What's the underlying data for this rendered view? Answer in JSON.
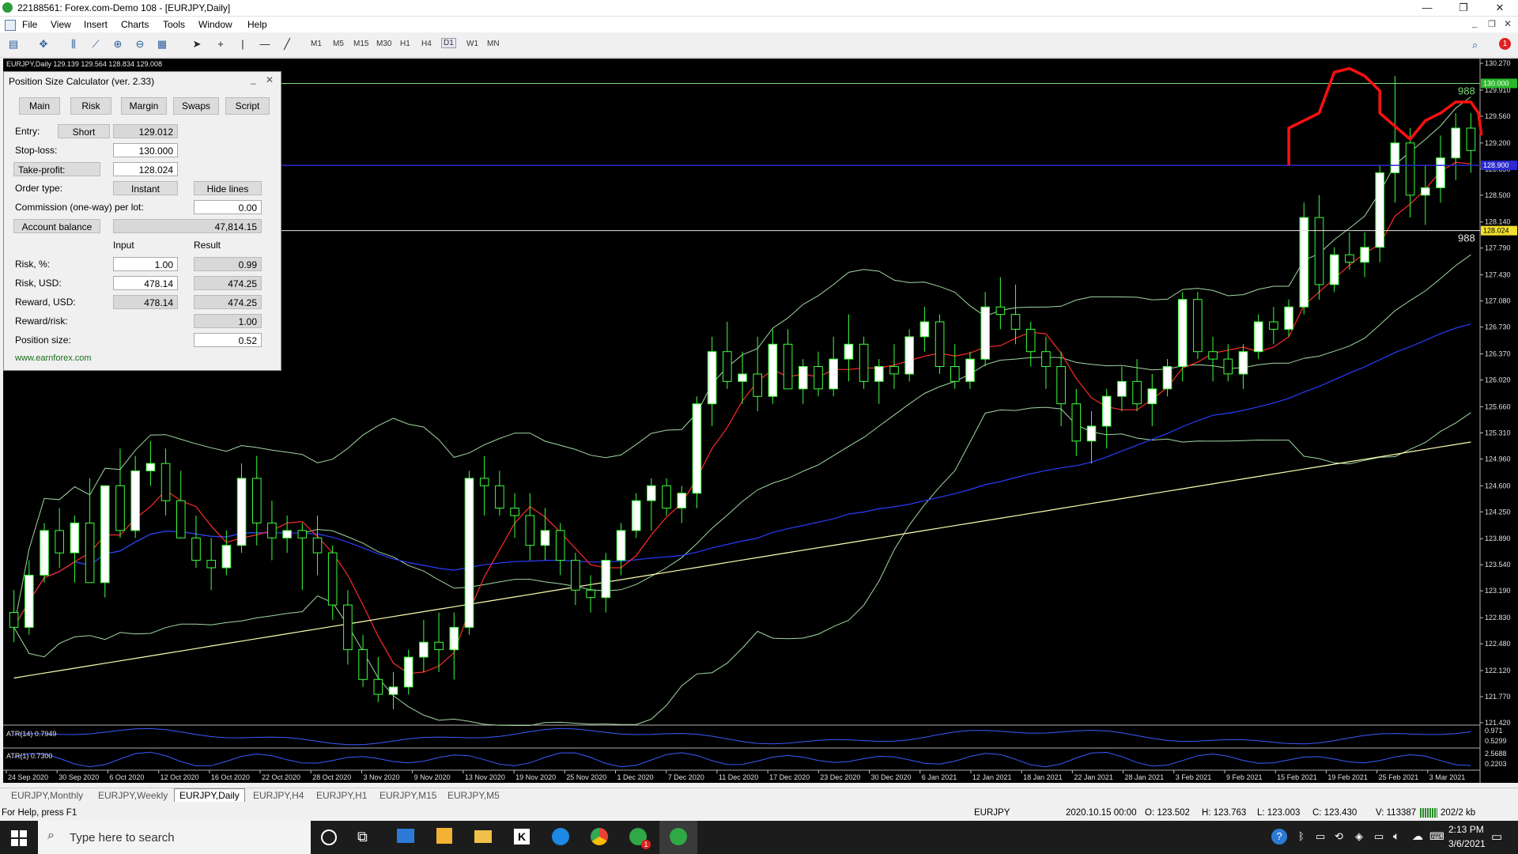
{
  "window": {
    "title": "22188561: Forex.com-Demo 108 - [EURJPY,Daily]",
    "controls": [
      "—",
      "❐",
      "✕"
    ]
  },
  "menu": [
    "File",
    "View",
    "Insert",
    "Charts",
    "Tools",
    "Window",
    "Help"
  ],
  "toolbar": {
    "timeframes": [
      "M1",
      "M5",
      "M15",
      "M30",
      "H1",
      "H4",
      "D1",
      "W1",
      "MN"
    ],
    "active_timeframe": "D1",
    "notification_count": "1"
  },
  "chart": {
    "header": "EURJPY,Daily  129.139 129.564 128.834 129.008",
    "price_ticks": [
      "130.270",
      "129.910",
      "129.560",
      "129.200",
      "128.850",
      "128.500",
      "128.140",
      "127.790",
      "127.430",
      "127.080",
      "126.730",
      "126.370",
      "126.020",
      "125.660",
      "125.310",
      "124.960",
      "124.600",
      "124.250",
      "123.890",
      "123.540",
      "123.190",
      "122.830",
      "122.480",
      "122.120",
      "121.770",
      "121.420"
    ],
    "level_labels": {
      "stop": "130.000",
      "take": "128.024",
      "current": "128.900"
    },
    "line_labels": [
      "988",
      "988"
    ],
    "date_ticks": [
      "24 Sep 2020",
      "30 Sep 2020",
      "6 Oct 2020",
      "12 Oct 2020",
      "16 Oct 2020",
      "22 Oct 2020",
      "28 Oct 2020",
      "3 Nov 2020",
      "9 Nov 2020",
      "13 Nov 2020",
      "19 Nov 2020",
      "25 Nov 2020",
      "1 Dec 2020",
      "7 Dec 2020",
      "11 Dec 2020",
      "17 Dec 2020",
      "23 Dec 2020",
      "30 Dec 2020",
      "6 Jan 2021",
      "12 Jan 2021",
      "18 Jan 2021",
      "22 Jan 2021",
      "28 Jan 2021",
      "3 Feb 2021",
      "9 Feb 2021",
      "15 Feb 2021",
      "19 Feb 2021",
      "25 Feb 2021",
      "3 Mar 2021"
    ],
    "atr14": {
      "label": "ATR(14) 0.7949",
      "ticks": [
        "0.971",
        "0.5299"
      ]
    },
    "atr1": {
      "label": "ATR(1) 0.7300",
      "ticks": [
        "2.5688",
        "0.2203"
      ]
    },
    "colors": {
      "bull": "#ffffff",
      "bear": "#000000",
      "wick": "#3cff3c",
      "ema_red": "#ff2a2a",
      "ema_blue": "#2a3cff",
      "bands": "#a0d8a0",
      "yellow": "#ffffb0"
    }
  },
  "chart_data": {
    "type": "candlestick",
    "symbol": "EURJPY",
    "period": "Daily",
    "ylim": [
      121.42,
      130.27
    ],
    "ohlc": [
      [
        122.9,
        123.2,
        122.5,
        122.7
      ],
      [
        122.7,
        123.6,
        122.6,
        123.4
      ],
      [
        123.4,
        124.1,
        123.3,
        124.0
      ],
      [
        124.0,
        124.3,
        123.5,
        123.7
      ],
      [
        123.7,
        124.2,
        123.3,
        124.1
      ],
      [
        124.1,
        124.7,
        123.6,
        123.3
      ],
      [
        123.3,
        124.6,
        123.1,
        124.6
      ],
      [
        124.6,
        125.1,
        123.9,
        124.0
      ],
      [
        124.0,
        125.0,
        123.9,
        124.8
      ],
      [
        124.8,
        125.2,
        124.6,
        124.9
      ],
      [
        124.9,
        125.1,
        124.2,
        124.4
      ],
      [
        124.4,
        124.8,
        124.0,
        123.9
      ],
      [
        123.9,
        124.2,
        123.5,
        123.6
      ],
      [
        123.6,
        123.9,
        123.2,
        123.5
      ],
      [
        123.5,
        124.0,
        123.4,
        123.8
      ],
      [
        123.8,
        124.9,
        123.7,
        124.7
      ],
      [
        124.7,
        125.0,
        123.8,
        124.1
      ],
      [
        124.1,
        124.4,
        123.6,
        123.9
      ],
      [
        123.9,
        124.2,
        123.7,
        124.0
      ],
      [
        124.0,
        124.1,
        123.2,
        123.9
      ],
      [
        123.9,
        124.2,
        123.4,
        123.7
      ],
      [
        123.7,
        123.8,
        122.8,
        123.0
      ],
      [
        123.0,
        123.2,
        122.2,
        122.4
      ],
      [
        122.4,
        122.6,
        121.9,
        122.0
      ],
      [
        122.0,
        122.3,
        121.7,
        121.8
      ],
      [
        121.8,
        122.1,
        121.6,
        121.9
      ],
      [
        121.9,
        122.4,
        121.8,
        122.3
      ],
      [
        122.3,
        122.8,
        122.1,
        122.5
      ],
      [
        122.5,
        122.9,
        122.1,
        122.4
      ],
      [
        122.4,
        122.9,
        122.0,
        122.7
      ],
      [
        122.7,
        124.8,
        122.6,
        124.7
      ],
      [
        124.7,
        125.0,
        124.2,
        124.6
      ],
      [
        124.6,
        124.8,
        124.2,
        124.3
      ],
      [
        124.3,
        124.5,
        123.9,
        124.2
      ],
      [
        124.2,
        124.5,
        123.6,
        123.8
      ],
      [
        123.8,
        124.3,
        123.6,
        124.0
      ],
      [
        124.0,
        124.1,
        123.4,
        123.6
      ],
      [
        123.6,
        123.7,
        123.0,
        123.2
      ],
      [
        123.2,
        123.4,
        122.9,
        123.1
      ],
      [
        123.1,
        123.7,
        122.9,
        123.6
      ],
      [
        123.6,
        124.1,
        123.4,
        124.0
      ],
      [
        124.0,
        124.5,
        123.9,
        124.4
      ],
      [
        124.4,
        124.7,
        124.0,
        124.6
      ],
      [
        124.6,
        124.7,
        124.2,
        124.3
      ],
      [
        124.3,
        124.6,
        124.1,
        124.5
      ],
      [
        124.5,
        125.8,
        124.3,
        125.7
      ],
      [
        125.7,
        126.6,
        125.4,
        126.4
      ],
      [
        126.4,
        126.8,
        125.9,
        126.0
      ],
      [
        126.0,
        126.4,
        125.7,
        126.1
      ],
      [
        126.1,
        126.6,
        125.6,
        125.8
      ],
      [
        125.8,
        126.7,
        125.7,
        126.5
      ],
      [
        126.5,
        126.7,
        125.9,
        125.9
      ],
      [
        125.9,
        126.3,
        125.7,
        126.2
      ],
      [
        126.2,
        126.4,
        125.8,
        125.9
      ],
      [
        125.9,
        126.6,
        125.8,
        126.3
      ],
      [
        126.3,
        126.9,
        126.0,
        126.5
      ],
      [
        126.5,
        126.6,
        125.9,
        126.0
      ],
      [
        126.0,
        126.3,
        125.7,
        126.2
      ],
      [
        126.2,
        126.5,
        125.9,
        126.1
      ],
      [
        126.1,
        126.7,
        126.0,
        126.6
      ],
      [
        126.6,
        127.0,
        126.4,
        126.8
      ],
      [
        126.8,
        126.9,
        126.1,
        126.2
      ],
      [
        126.2,
        126.5,
        125.9,
        126.0
      ],
      [
        126.0,
        126.4,
        125.9,
        126.3
      ],
      [
        126.3,
        127.2,
        126.2,
        127.0
      ],
      [
        127.0,
        127.4,
        126.7,
        126.9
      ],
      [
        126.9,
        127.3,
        126.5,
        126.7
      ],
      [
        126.7,
        126.8,
        126.2,
        126.4
      ],
      [
        126.4,
        126.6,
        125.9,
        126.2
      ],
      [
        126.2,
        126.4,
        125.4,
        125.7
      ],
      [
        125.7,
        125.9,
        125.0,
        125.2
      ],
      [
        125.2,
        125.6,
        124.9,
        125.4
      ],
      [
        125.4,
        125.9,
        125.1,
        125.8
      ],
      [
        125.8,
        126.2,
        125.6,
        126.0
      ],
      [
        126.0,
        126.3,
        125.6,
        125.7
      ],
      [
        125.7,
        126.1,
        125.4,
        125.9
      ],
      [
        125.9,
        126.3,
        125.8,
        126.2
      ],
      [
        126.2,
        127.2,
        126.0,
        127.1
      ],
      [
        127.1,
        127.2,
        126.3,
        126.4
      ],
      [
        126.4,
        126.6,
        126.0,
        126.3
      ],
      [
        126.3,
        126.5,
        126.0,
        126.1
      ],
      [
        126.1,
        126.5,
        125.9,
        126.4
      ],
      [
        126.4,
        126.9,
        126.3,
        126.8
      ],
      [
        126.8,
        127.0,
        126.5,
        126.7
      ],
      [
        126.7,
        127.1,
        126.6,
        127.0
      ],
      [
        127.0,
        128.4,
        126.9,
        128.2
      ],
      [
        128.2,
        128.5,
        127.1,
        127.3
      ],
      [
        127.3,
        127.8,
        127.2,
        127.7
      ],
      [
        127.7,
        128.0,
        127.5,
        127.6
      ],
      [
        127.6,
        128.0,
        127.4,
        127.8
      ],
      [
        127.8,
        128.9,
        127.6,
        128.8
      ],
      [
        128.8,
        130.1,
        128.4,
        129.2
      ],
      [
        129.2,
        129.4,
        128.2,
        128.5
      ],
      [
        128.5,
        128.9,
        128.1,
        128.6
      ],
      [
        128.6,
        129.3,
        128.4,
        129.0
      ],
      [
        129.0,
        129.6,
        128.7,
        129.4
      ],
      [
        129.4,
        129.6,
        128.8,
        129.1
      ]
    ]
  },
  "calculator": {
    "title": "Position Size Calculator (ver. 2.33)",
    "tabs": [
      "Main",
      "Risk",
      "Margin",
      "Swaps",
      "Script"
    ],
    "entry_label": "Entry:",
    "direction": "Short",
    "entry_value": "129.012",
    "stop_label": "Stop-loss:",
    "stop_value": "130.000",
    "take_label": "Take-profit:",
    "take_value": "128.024",
    "order_type_label": "Order type:",
    "order_type": "Instant",
    "hide_lines": "Hide lines",
    "commission_label": "Commission (one-way) per lot:",
    "commission_value": "0.00",
    "account_balance_label": "Account balance",
    "account_balance_value": "47,814.15",
    "col_input": "Input",
    "col_result": "Result",
    "risk_pct_label": "Risk, %:",
    "risk_pct_input": "1.00",
    "risk_pct_result": "0.99",
    "risk_usd_label": "Risk, USD:",
    "risk_usd_input": "478.14",
    "risk_usd_result": "474.25",
    "reward_usd_label": "Reward, USD:",
    "reward_usd_input": "478.14",
    "reward_usd_result": "474.25",
    "reward_risk_label": "Reward/risk:",
    "reward_risk_result": "1.00",
    "position_size_label": "Position size:",
    "position_size_result": "0.52",
    "link": "www.earnforex.com"
  },
  "symbol_tabs": [
    "EURJPY,Monthly",
    "EURJPY,Weekly",
    "EURJPY,Daily",
    "EURJPY,H4",
    "EURJPY,H1",
    "EURJPY,M15",
    "EURJPY,M5"
  ],
  "active_symbol_tab": "EURJPY,Daily",
  "status": {
    "help": "For Help, press F1",
    "symbol": "EURJPY",
    "datetime": "2020.10.15 00:00",
    "open": "O: 123.502",
    "high": "H: 123.763",
    "low": "L: 123.003",
    "close": "C: 123.430",
    "volume": "V: 113387",
    "traffic": "202/2 kb"
  },
  "taskbar": {
    "search_placeholder": "Type here to search",
    "time": "2:13 PM",
    "date": "3/6/2021",
    "notification_badge": "1"
  }
}
